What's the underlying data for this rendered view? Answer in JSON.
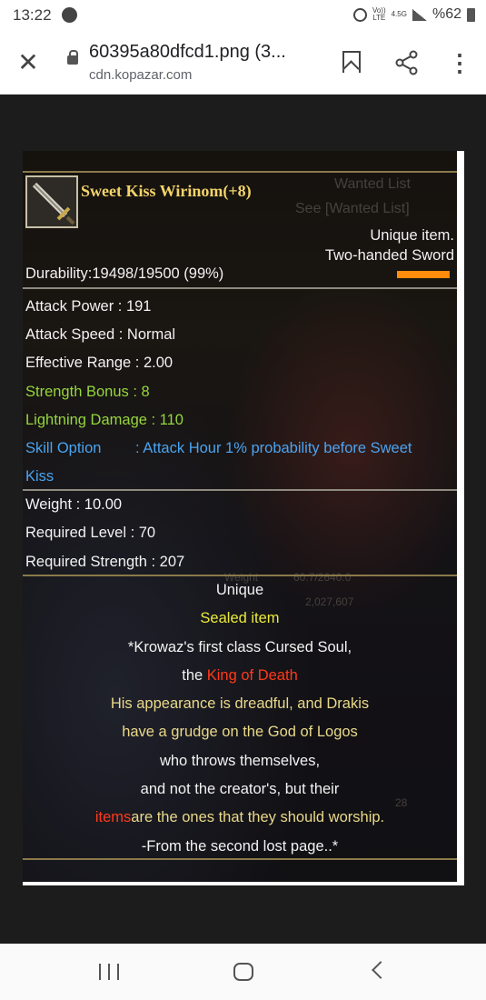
{
  "status": {
    "time": "13:22",
    "net_small_top": "Vo))",
    "net_small_bottom": "LTE",
    "net_type": "4.5G",
    "battery": "%62"
  },
  "browser": {
    "title": "60395a80dfcd1.png (3...",
    "host": "cdn.kopazar.com"
  },
  "item": {
    "name": "Sweet Kiss Wirinom(+8)",
    "rarity": "Unique item.",
    "type": "Two-handed Sword",
    "durability": "Durability:19498/19500 (99%)",
    "durability_fraction": 0.999,
    "stats": [
      "Attack Power : 191",
      "Attack Speed : Normal",
      "Effective Range : 2.00"
    ],
    "bonuses": [
      "Strength Bonus : 8",
      "Lightning Damage : 110"
    ],
    "skill_label": "Skill Option",
    "skill_text": ": Attack Hour 1% probability before Sweet",
    "skill_text_cont": "Kiss",
    "requirements": [
      "Weight : 10.00",
      "Required Level : 70",
      "Required Strength : 207"
    ],
    "unique_label": "Unique",
    "sealed_label": "Sealed item",
    "lore": {
      "line1": "*Krowaz's first class Cursed Soul,",
      "line2_a": "the ",
      "line2_b": "King of Death",
      "line3": "His appearance is dreadful, and Drakis",
      "line4": "have a grudge on the God of Logos",
      "line5": "who throws themselves,",
      "line6": "and not the creator's, but their",
      "line7_a": "items",
      "line7_b": "are the ones that they should worship.",
      "line8": "-From the second lost page..*"
    }
  },
  "background_text": {
    "wanted_list": "Wanted List",
    "see_wanted": "See [Wanted List]",
    "weight_label": "Weight",
    "weight_value": "60.7/2640.0",
    "money": "2,027,607",
    "slot_count": "28"
  },
  "colors": {
    "title": "#f3d46a",
    "bonus_green": "#96d63c",
    "skill_blue": "#4aa3f0",
    "sealed_yellow": "#eaea3a",
    "lore_gold": "#e9d98a",
    "highlight_red": "#ff3a1a",
    "durability_bar": "#ff8c0a"
  }
}
